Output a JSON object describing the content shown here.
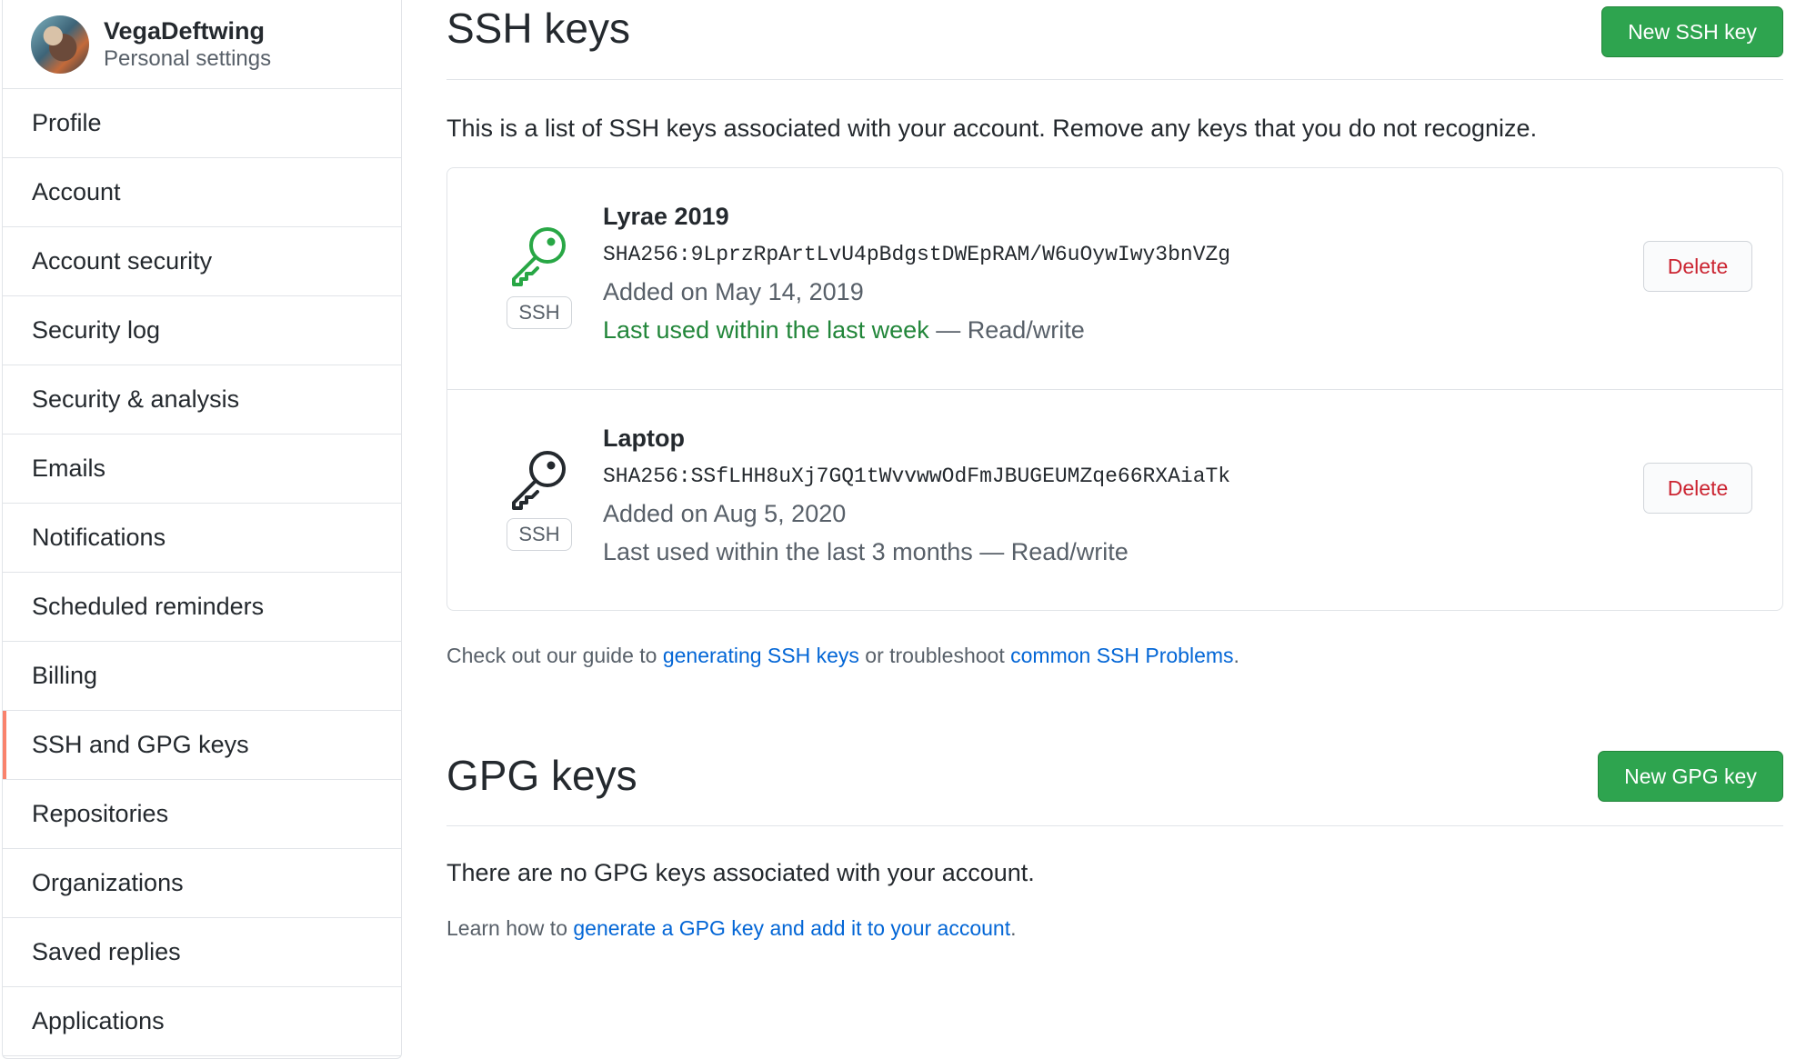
{
  "user": {
    "name": "VegaDeftwing",
    "subtitle": "Personal settings"
  },
  "sidebar": {
    "items": [
      {
        "label": "Profile"
      },
      {
        "label": "Account"
      },
      {
        "label": "Account security"
      },
      {
        "label": "Security log"
      },
      {
        "label": "Security & analysis"
      },
      {
        "label": "Emails"
      },
      {
        "label": "Notifications"
      },
      {
        "label": "Scheduled reminders"
      },
      {
        "label": "Billing"
      },
      {
        "label": "SSH and GPG keys",
        "selected": true
      },
      {
        "label": "Repositories"
      },
      {
        "label": "Organizations"
      },
      {
        "label": "Saved replies"
      },
      {
        "label": "Applications"
      }
    ],
    "selected_accent": "#f9826c"
  },
  "ssh": {
    "title": "SSH keys",
    "new_button": "New SSH key",
    "intro": "This is a list of SSH keys associated with your account. Remove any keys that you do not recognize.",
    "keys": [
      {
        "name": "Lyrae 2019",
        "fingerprint": "SHA256:9LprzRpArtLvU4pBdgstDWEpRAM/W6uOywIwy3bnVZg",
        "added": "Added on May 14, 2019",
        "last_used": "Last used within the last week",
        "access": " — Read/write",
        "badge": "SSH",
        "icon": "key-icon",
        "icon_color": "#28a745",
        "delete_label": "Delete"
      },
      {
        "name": "Laptop",
        "fingerprint": "SHA256:SSfLHH8uXj7GQ1tWvvwwOdFmJBUGEUMZqe66RXAiaTk",
        "added": "Added on Aug 5, 2020",
        "last_used": "Last used within the last 3 months",
        "access": " — Read/write",
        "badge": "SSH",
        "icon": "key-icon",
        "icon_color": "#24292e",
        "delete_label": "Delete"
      }
    ],
    "help_prefix": "Check out our guide to ",
    "help_link1": "generating SSH keys",
    "help_middle": " or troubleshoot ",
    "help_link2": "common SSH Problems",
    "help_suffix": "."
  },
  "gpg": {
    "title": "GPG keys",
    "new_button": "New GPG key",
    "empty": "There are no GPG keys associated with your account.",
    "help_prefix": "Learn how to ",
    "help_link": "generate a GPG key and add it to your account",
    "help_suffix": "."
  },
  "colors": {
    "primary_button": "#2ea44f",
    "link": "#0366d6",
    "danger": "#cb2431"
  }
}
